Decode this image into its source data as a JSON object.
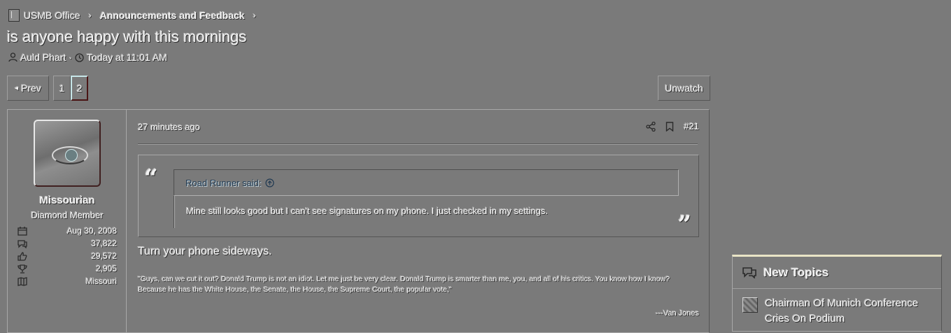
{
  "breadcrumb": {
    "items": [
      "USMB Office",
      "Announcements and Feedback"
    ],
    "separator": "›"
  },
  "thread": {
    "title": "is anyone happy with this mornings",
    "author": "Auld Phart",
    "meta_separator": "·",
    "time": "Today at 11:01 AM"
  },
  "pagination": {
    "prev_label": "Prev",
    "pages": [
      "1",
      "2"
    ],
    "current": "2",
    "unwatch_label": "Unwatch"
  },
  "post": {
    "time_ago": "27 minutes ago",
    "post_number": "#21",
    "user": {
      "name": "Missourian",
      "title": "Diamond Member",
      "stats": [
        {
          "icon": "calendar-icon",
          "value": "Aug 30, 2008"
        },
        {
          "icon": "messages-icon",
          "value": "37,822"
        },
        {
          "icon": "thumbs-up-icon",
          "value": "29,572"
        },
        {
          "icon": "trophy-icon",
          "value": "2,905"
        },
        {
          "icon": "map-icon",
          "value": "Missouri"
        }
      ]
    },
    "quote": {
      "author_line": "Road Runner said:",
      "text": "Mine still looks good but I can't see signatures on my phone. I just checked in my settings."
    },
    "reply": "Turn your phone sideways.",
    "signature": {
      "text": "\"Guys, can we cut it out? Donald Trump is not an idiot. Let me just be very clear. Donald Trump is smarter than me, you, and all of his critics. You know how I know? Because he has the White House, the Senate, the House, the Supreme Court, the popular vote,\"",
      "attribution": "---Van Jones"
    }
  },
  "sidebar": {
    "new_topics_title": "New Topics",
    "topics": [
      "Chairman Of Munich Conference Cries On Podium"
    ]
  },
  "colors": {
    "background": "#7a7a7a",
    "active_page_border": "#4a1515",
    "quote_author": "#213a52",
    "block_top_accent": "#e9e4c6"
  }
}
